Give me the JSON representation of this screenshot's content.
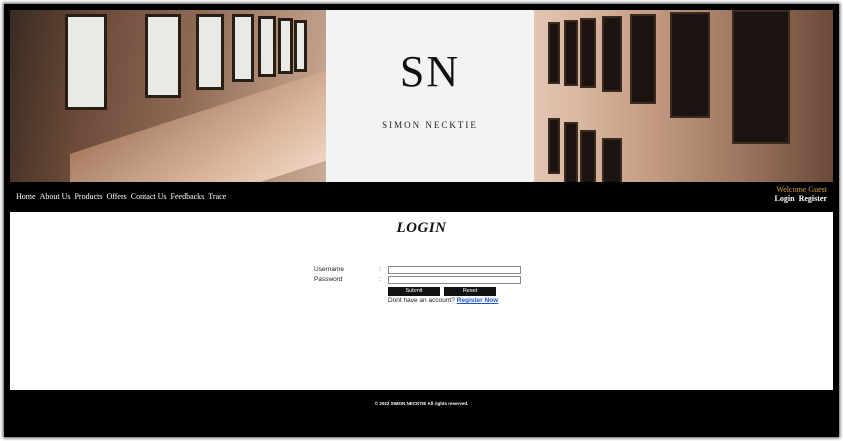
{
  "header": {
    "logo": "SN",
    "brand_name": "SIMON NECKTIE"
  },
  "nav": {
    "items": [
      "Home",
      "About Us",
      "Products",
      "Offers",
      "Contact Us",
      "Feedbacks",
      "Trace"
    ],
    "welcome": "Welcome Guest",
    "login": "Login",
    "register": "Register"
  },
  "login_form": {
    "title": "LOGIN",
    "username_label": "Username",
    "password_label": "Password",
    "colon": ":",
    "username_value": "",
    "password_value": "",
    "submit_label": "Submit",
    "reset_label": "Reset",
    "no_account_text": "Dont have an account?",
    "register_link": "Register Now"
  },
  "footer": {
    "copyright": "© 2022 SIMON NECKTIE All rights reserved."
  }
}
